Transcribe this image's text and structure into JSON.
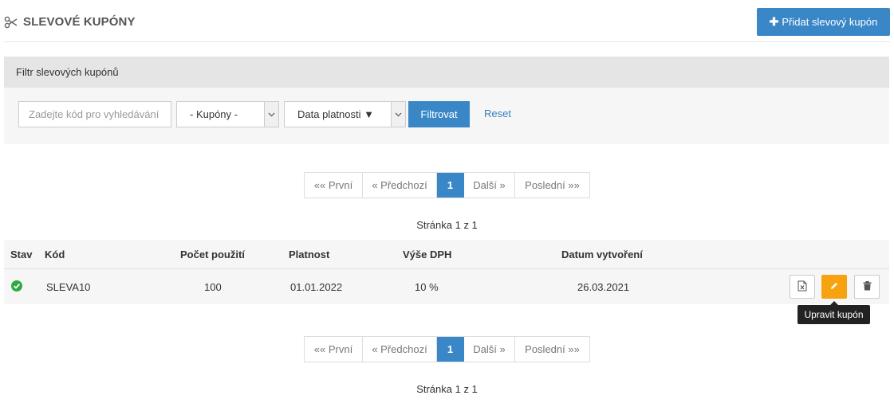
{
  "header": {
    "title": "SLEVOVÉ KUPÓNY",
    "title_icon": "scissors-icon",
    "add_button_label": "Přidat slevový kupón"
  },
  "filter": {
    "heading": "Filtr slevových kupónů",
    "search_placeholder": "Zadejte kód pro vyhledávání",
    "coupons_select_value": "- Kupóny -",
    "validity_select_value": "Data platnosti ▼",
    "filter_button_label": "Filtrovat",
    "reset_label": "Reset"
  },
  "pagination": {
    "first": "«« První",
    "prev": "« Předchozí",
    "current": "1",
    "next": "Další »",
    "last": "Poslední »»",
    "info": "Stránka 1 z 1"
  },
  "table": {
    "columns": {
      "status": "Stav",
      "code": "Kód",
      "uses": "Počet použití",
      "validity": "Platnost",
      "vat": "Výše DPH",
      "created": "Datum vytvoření"
    },
    "rows": [
      {
        "status": "active",
        "code": "SLEVA10",
        "uses": "100",
        "validity": "01.01.2022",
        "vat": "10 %",
        "created": "26.03.2021"
      }
    ]
  },
  "tooltip": {
    "text": "Upravit kupón"
  },
  "colors": {
    "primary": "#3a87c8",
    "edit": "#f7a20f",
    "status_ok": "#2eaa43"
  }
}
